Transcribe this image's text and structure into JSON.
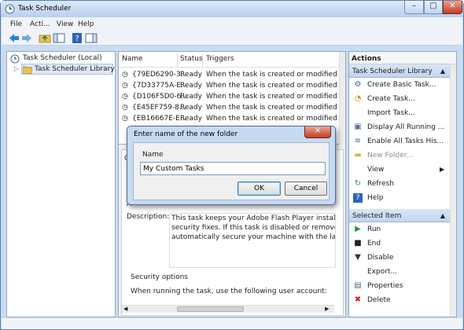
{
  "window": {
    "title": "Task Scheduler",
    "minimize": "–",
    "maximize": "□",
    "close": "✕"
  },
  "menu": [
    "File",
    "Acti...",
    "View",
    "Help"
  ],
  "toolbar_icons": [
    "back-arrow-icon",
    "forward-arrow-icon",
    "up-folder-icon",
    "show-hide-pane-icon",
    "help-icon",
    "properties-pane-icon"
  ],
  "tree": {
    "root": "Task Scheduler (Local)",
    "library": "Task Scheduler Library"
  },
  "task_list": {
    "columns": [
      "Name",
      "Status",
      "Triggers"
    ],
    "rows": [
      {
        "name": "{79ED6290-3...",
        "status": "Ready",
        "trigger": "When the task is created or modified"
      },
      {
        "name": "{7D33775A-E...",
        "status": "Ready",
        "trigger": "When the task is created or modified"
      },
      {
        "name": "{D106F5D0-6...",
        "status": "Ready",
        "trigger": "When the task is created or modified"
      },
      {
        "name": "{E45EF759-8...",
        "status": "Ready",
        "trigger": "When the task is created or modified"
      },
      {
        "name": "{EB16667E-E...",
        "status": "Ready",
        "trigger": "When the task is created or modified"
      }
    ]
  },
  "details": {
    "tab_fragment_g": "G",
    "fragment_l": "L",
    "fragment_a": "A",
    "description_label": "Description:",
    "description_lines": [
      "This task keeps your Adobe Flash Player installation",
      "security fixes. If this task is disabled or removed, Ado",
      "automatically secure your machine with the latest se"
    ],
    "security_options": "Security options",
    "run_as_text": "When running the task, use the following user account:"
  },
  "actions": {
    "header": "Actions",
    "section1": "Task Scheduler Library",
    "items1": [
      {
        "label": "Create Basic Task...",
        "icon": "create-basic-task-icon",
        "glyph": "⚙",
        "color": "#3a6ea5",
        "enabled": true
      },
      {
        "label": "Create Task...",
        "icon": "create-task-icon",
        "glyph": "◔",
        "color": "#c88a1a",
        "enabled": true
      },
      {
        "label": "Import Task...",
        "icon": "import-task-icon",
        "glyph": "",
        "color": "#3a6ea5",
        "enabled": true
      },
      {
        "label": "Display All Running ...",
        "icon": "running-tasks-icon",
        "glyph": "▣",
        "color": "#4a6f95",
        "enabled": true
      },
      {
        "label": "Enable All Tasks His...",
        "icon": "history-icon",
        "glyph": "≡",
        "color": "#4a6f95",
        "enabled": true
      },
      {
        "label": "New Folder...",
        "icon": "new-folder-icon",
        "glyph": "▬",
        "color": "#d9b24a",
        "enabled": false
      },
      {
        "label": "View",
        "icon": "",
        "glyph": "",
        "color": "#000000",
        "enabled": true,
        "submenu": "▶"
      },
      {
        "label": "Refresh",
        "icon": "refresh-icon",
        "glyph": "↻",
        "color": "#2f8f3a",
        "enabled": true
      },
      {
        "label": "Help",
        "icon": "help-icon",
        "glyph": "?",
        "color": "#ffffff",
        "enabled": true
      }
    ],
    "section2": "Selected Item",
    "items2": [
      {
        "label": "Run",
        "icon": "run-icon",
        "glyph": "▶",
        "color": "#2f9a2f",
        "enabled": true
      },
      {
        "label": "End",
        "icon": "end-icon",
        "glyph": "■",
        "color": "#222222",
        "enabled": true
      },
      {
        "label": "Disable",
        "icon": "disable-icon",
        "glyph": "▼",
        "color": "#333333",
        "enabled": true
      },
      {
        "label": "Export...",
        "icon": "",
        "glyph": "",
        "color": "#000000",
        "enabled": true
      },
      {
        "label": "Properties",
        "icon": "properties-icon",
        "glyph": "▤",
        "color": "#4a6f95",
        "enabled": true
      },
      {
        "label": "Delete",
        "icon": "delete-icon",
        "glyph": "✖",
        "color": "#d42020",
        "enabled": true
      }
    ],
    "collapse_glyph": "▲"
  },
  "dialog": {
    "title": "Enter name of the new folder",
    "close": "✕",
    "name_label": "Name",
    "name_value": "My Custom Tasks",
    "ok": "OK",
    "cancel": "Cancel"
  },
  "colors": {
    "title_bar": "#c8dcf2",
    "selection": "#dde9f6",
    "close_red": "#c53b22"
  }
}
